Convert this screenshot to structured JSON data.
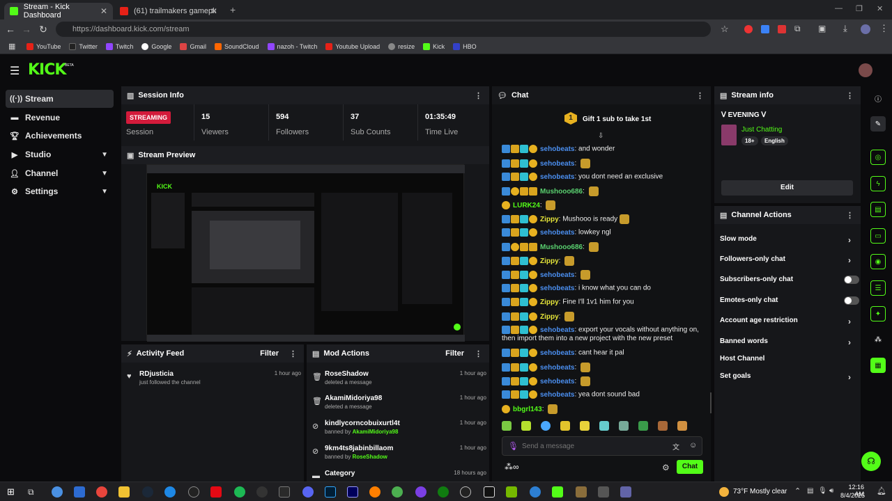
{
  "browser": {
    "tabs": [
      {
        "label": "Stream - Kick Dashboard",
        "active": true
      },
      {
        "label": "(61) trailmakers gameplay - You",
        "active": false
      }
    ],
    "url": "https://dashboard.kick.com/stream",
    "bookmarks": [
      "YouTube",
      "Twitter",
      "Twitch",
      "Google",
      "Gmail",
      "SoundCloud",
      "nazoh - Twitch",
      "Youtube Upload",
      "resize",
      "Kick",
      "HBO"
    ]
  },
  "app": {
    "logo": "KICK",
    "logo_sup": "BETA",
    "accent": "#53fc18"
  },
  "sidebar": {
    "items": [
      {
        "label": "Stream",
        "icon": "broadcast-icon",
        "active": true
      },
      {
        "label": "Revenue",
        "icon": "revenue-icon"
      },
      {
        "label": "Achievements",
        "icon": "trophy-icon"
      },
      {
        "label": "Studio",
        "icon": "studio-icon",
        "chevron": true
      },
      {
        "label": "Channel",
        "icon": "channel-icon",
        "chevron": true
      },
      {
        "label": "Settings",
        "icon": "gear-icon",
        "chevron": true
      }
    ]
  },
  "session": {
    "title": "Session Info",
    "status": "STREAMING",
    "status_label": "Session",
    "stats": [
      {
        "value": "15",
        "label": "Viewers"
      },
      {
        "value": "594",
        "label": "Followers"
      },
      {
        "value": "37",
        "label": "Sub Counts"
      },
      {
        "value": "01:35:49",
        "label": "Time Live"
      }
    ]
  },
  "preview": {
    "title": "Stream Preview"
  },
  "activity": {
    "title": "Activity Feed",
    "filter": "Filter",
    "items": [
      {
        "name": "RDjusticia",
        "desc": "just followed the channel",
        "time": "1 hour ago"
      }
    ]
  },
  "mod": {
    "title": "Mod Actions",
    "filter": "Filter",
    "items": [
      {
        "name": "RoseShadow",
        "desc": "deleted a message",
        "by": "",
        "time": "1 hour ago",
        "icon": "trash-icon"
      },
      {
        "name": "AkamiMidoriya98",
        "desc": "deleted a message",
        "by": "",
        "time": "1 hour ago",
        "icon": "trash-icon"
      },
      {
        "name": "kindlycorncobuixurtl4t",
        "desc": "banned by",
        "by": "AkamiMidoriya98",
        "time": "1 hour ago",
        "icon": "ban-icon"
      },
      {
        "name": "9km4ts8jabinbillaom",
        "desc": "banned by",
        "by": "RoseShadow",
        "time": "1 hour ago",
        "icon": "ban-icon"
      },
      {
        "name": "Category",
        "desc": "",
        "by": "",
        "time": "18 hours ago",
        "icon": "category-icon"
      }
    ]
  },
  "chat": {
    "title": "Chat",
    "gift": "Gift 1 sub to take 1st",
    "gift_count": "1",
    "messages": [
      {
        "user": "sehobeats",
        "text": "and wonder",
        "color": "blue"
      },
      {
        "user": "sehobeats",
        "text": "",
        "color": "blue",
        "emote": true
      },
      {
        "user": "sehobeats",
        "text": "you dont need an exclusive",
        "color": "blue"
      },
      {
        "user": "Mushooo686",
        "text": "",
        "color": "pink",
        "emote": true
      },
      {
        "user": "LURK24",
        "text": "",
        "color": "green",
        "emote": true
      },
      {
        "user": "Zippy",
        "text": "Mushooo is ready",
        "color": "yellow",
        "emote": true
      },
      {
        "user": "sehobeats",
        "text": "lowkey ngl",
        "color": "blue"
      },
      {
        "user": "Mushooo686",
        "text": "",
        "color": "pink",
        "emote": true
      },
      {
        "user": "Zippy",
        "text": "",
        "color": "yellow",
        "emote": true
      },
      {
        "user": "sehobeats",
        "text": "",
        "color": "blue",
        "emote": true
      },
      {
        "user": "sehobeats",
        "text": "i know what you can do",
        "color": "blue"
      },
      {
        "user": "Zippy",
        "text": "Fine I'll 1v1 him for you",
        "color": "yellow"
      },
      {
        "user": "Zippy",
        "text": "",
        "color": "yellow",
        "emote": true
      },
      {
        "user": "sehobeats",
        "text": "export your vocals without anything on,",
        "color": "blue"
      },
      {
        "user": "",
        "text": "then import them into a new project with the new preset",
        "color": "blue"
      },
      {
        "user": "sehobeats",
        "text": "cant hear it pal",
        "color": "blue"
      },
      {
        "user": "sehobeats",
        "text": "",
        "color": "blue",
        "emote": true
      },
      {
        "user": "sehobeats",
        "text": "",
        "color": "blue",
        "emote": true
      },
      {
        "user": "sehobeats",
        "text": "yea dont sound bad",
        "color": "blue"
      },
      {
        "user": "bbgrl143",
        "text": "",
        "color": "green",
        "emote": true
      }
    ],
    "placeholder": "Send a message",
    "send": "Chat"
  },
  "stream_info": {
    "title": "Stream info",
    "stream_title": "EVENING",
    "category": "Just Chatting",
    "tags": [
      "18+",
      "English"
    ],
    "edit": "Edit"
  },
  "channel_actions": {
    "title": "Channel Actions",
    "rows": [
      {
        "label": "Slow mode",
        "type": "arrow"
      },
      {
        "label": "Followers-only chat",
        "type": "arrow"
      },
      {
        "label": "Subscribers-only chat",
        "type": "toggle"
      },
      {
        "label": "Emotes-only chat",
        "type": "toggle"
      },
      {
        "label": "Account age restriction",
        "type": "arrow"
      },
      {
        "label": "Banned words",
        "type": "arrow"
      },
      {
        "label": "Host Channel",
        "type": "none"
      },
      {
        "label": "Set goals",
        "type": "arrow"
      }
    ]
  },
  "taskbar": {
    "weather": "73°F",
    "weather_desc": "Mostly clear",
    "time": "12:16 AM",
    "date": "8/4/2025"
  }
}
